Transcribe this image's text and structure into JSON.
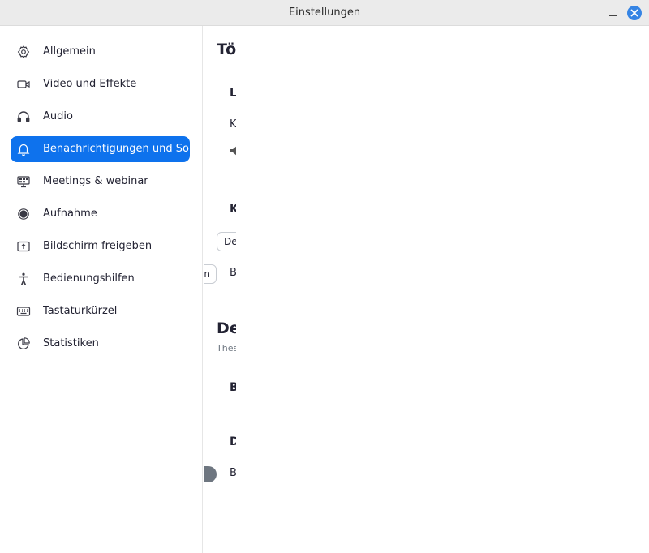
{
  "window": {
    "title": "Einstellungen",
    "accent": "#0e72ed"
  },
  "sidebar": {
    "items": [
      {
        "label": "Allgemein",
        "icon": "gear-icon"
      },
      {
        "label": "Video und Effekte",
        "icon": "video-camera-icon"
      },
      {
        "label": "Audio",
        "icon": "headphones-icon"
      },
      {
        "label": "Benachrichtigungen und So...",
        "icon": "bell-icon",
        "active": true
      },
      {
        "label": "Meetings & webinar",
        "icon": "meeting-presentation-icon"
      },
      {
        "label": "Aufnahme",
        "icon": "record-icon"
      },
      {
        "label": "Bildschirm freigeben",
        "icon": "share-screen-icon"
      },
      {
        "label": "Bedienungshilfen",
        "icon": "accessibility-icon"
      },
      {
        "label": "Tastaturkürzel",
        "icon": "keyboard-icon"
      },
      {
        "label": "Statistiken",
        "icon": "pie-chart-icon"
      }
    ]
  },
  "main": {
    "heading1": "Tön",
    "section1_label": "L",
    "row1_text": "K",
    "section2_label": "K",
    "select_value": "De",
    "button_fragment": "n",
    "button_row_text": "B",
    "heading2": "De",
    "heading2_sub": "Thes",
    "section3_label": "B",
    "section4_label": "D",
    "toggle_row_text": "B"
  }
}
